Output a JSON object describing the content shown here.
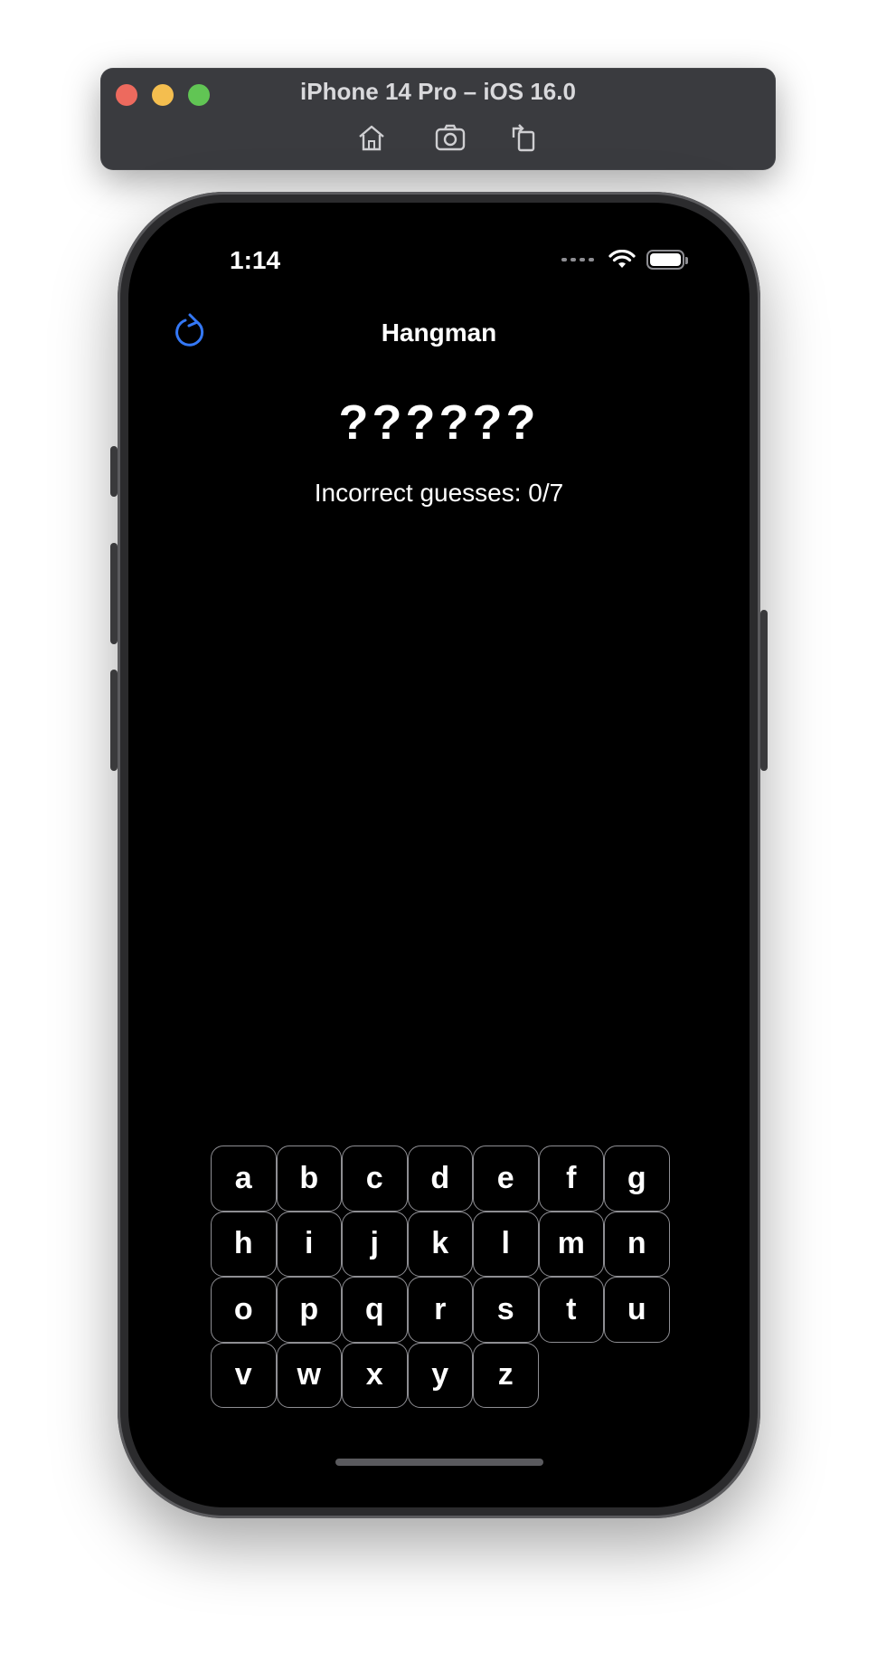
{
  "simulator": {
    "title": "iPhone 14 Pro – iOS 16.0",
    "tools": [
      "home-icon",
      "screenshot-icon",
      "rotate-icon"
    ]
  },
  "status_bar": {
    "time": "1:14"
  },
  "nav": {
    "title": "Hangman",
    "left_icon": "reload-icon",
    "accent_color": "#3478f6"
  },
  "game": {
    "masked_word": "??????",
    "incorrect_guesses": "Incorrect guesses: 0/7"
  },
  "keyboard": {
    "rows": [
      [
        "a",
        "b",
        "c",
        "d",
        "e",
        "f",
        "g"
      ],
      [
        "h",
        "i",
        "j",
        "k",
        "l",
        "m",
        "n"
      ],
      [
        "o",
        "p",
        "q",
        "r",
        "s",
        "t",
        "u"
      ],
      [
        "v",
        "w",
        "x",
        "y",
        "z"
      ]
    ]
  }
}
